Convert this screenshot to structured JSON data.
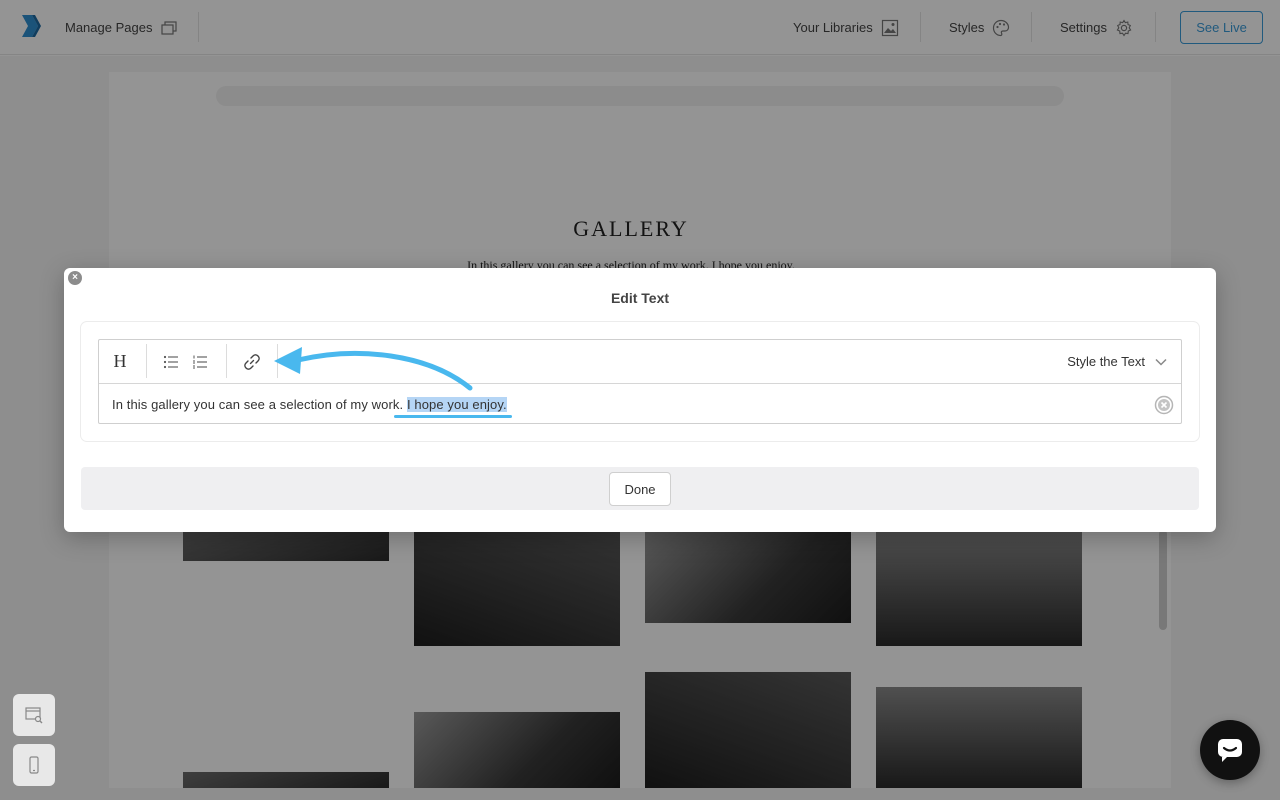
{
  "topbar": {
    "manage_pages": "Manage Pages",
    "your_libraries": "Your Libraries",
    "styles": "Styles",
    "settings": "Settings",
    "see_live": "See Live",
    "accent_color": "#3a9bd9"
  },
  "page": {
    "title": "GALLERY",
    "subtitle": "In this gallery you can see a selection of my work. I hope you enjoy."
  },
  "modal": {
    "title": "Edit Text",
    "toolbar": {
      "heading_label": "H",
      "bullet_list_icon": "bullet-list-icon",
      "numbered_list_icon": "numbered-list-icon",
      "link_icon": "link-icon",
      "style_select": "Style the Text"
    },
    "text_before": "In this gallery you can see a selection of my work. ",
    "text_selected": "I hope you enjoy.",
    "done_label": "Done",
    "highlight_color": "#49b8ee"
  }
}
